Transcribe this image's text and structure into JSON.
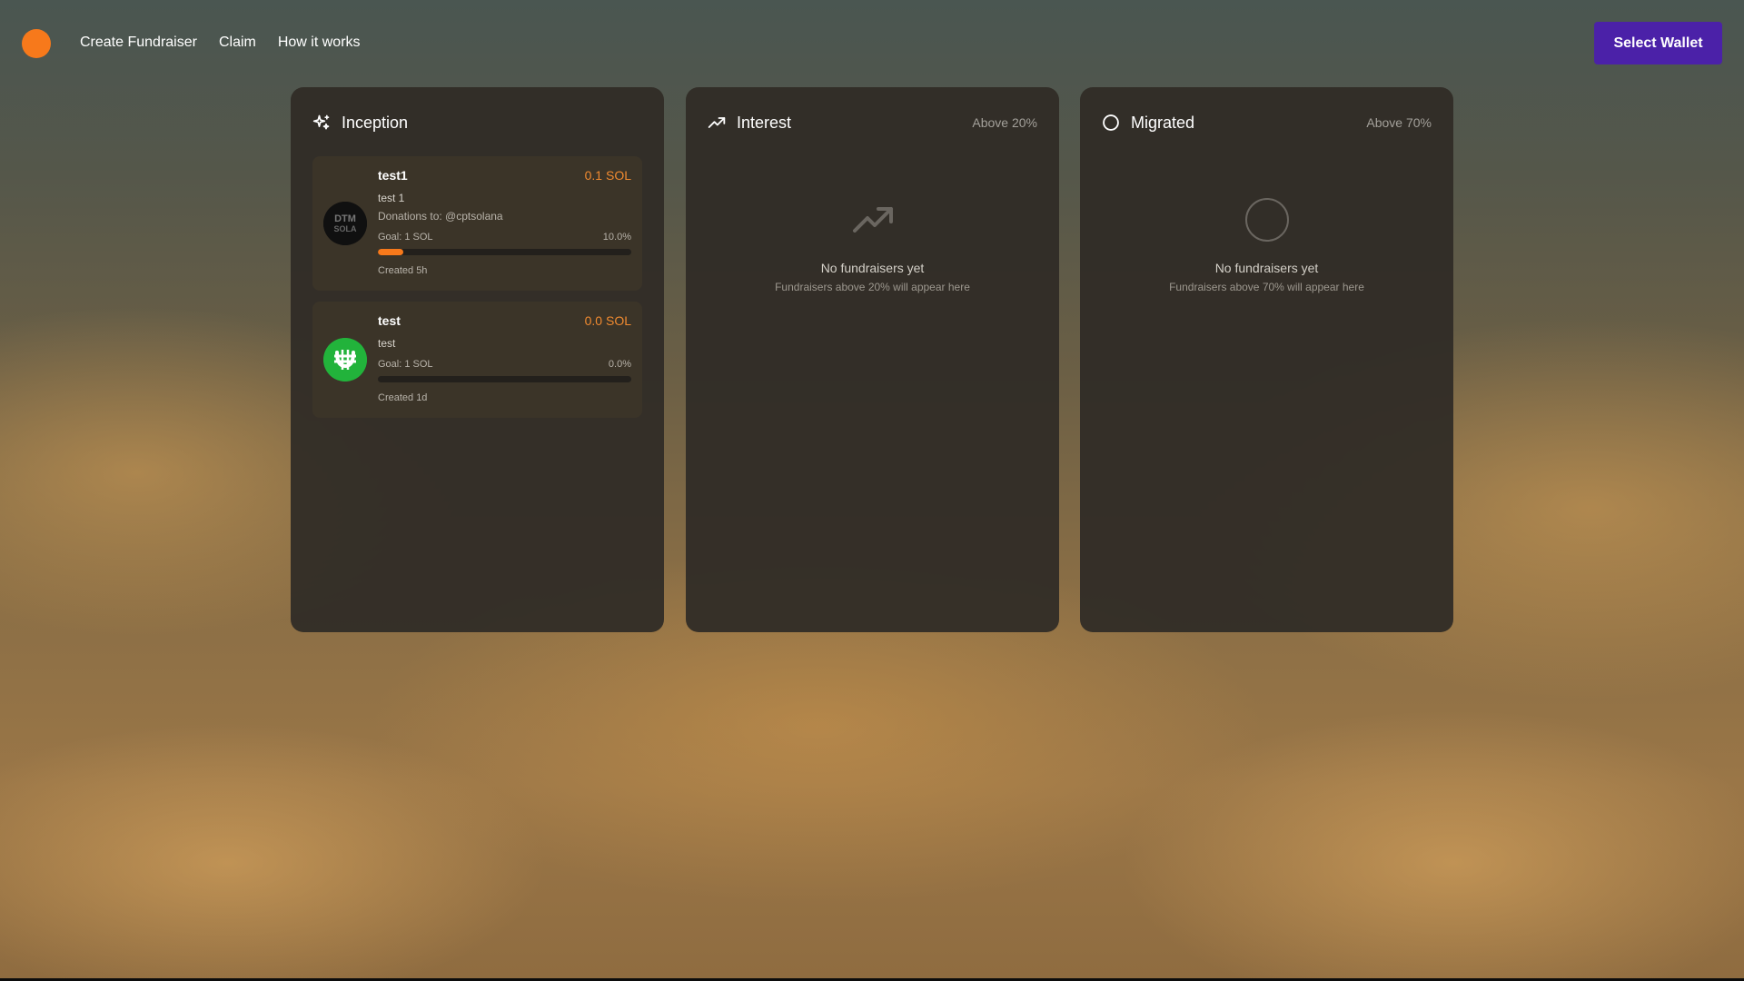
{
  "header": {
    "nav": [
      {
        "label": "Create Fundraiser"
      },
      {
        "label": "Claim"
      },
      {
        "label": "How it works"
      }
    ],
    "wallet_button": "Select Wallet",
    "logo_color": "#f7791b",
    "wallet_button_color": "#4b21a8"
  },
  "columns": {
    "inception": {
      "title": "Inception",
      "icon": "sparkles-icon",
      "cards": [
        {
          "name": "test1",
          "amount": "0.1 SOL",
          "description": "test 1",
          "recipient": "Donations to: @cptsolana",
          "goal": "Goal: 1 SOL",
          "percent_label": "10.0%",
          "progress": 0.1,
          "created": "Created 5h",
          "avatar": "dark-text-logo-avatar"
        },
        {
          "name": "test",
          "amount": "0.0 SOL",
          "description": "test",
          "goal": "Goal: 1 SOL",
          "percent_label": "0.0%",
          "progress": 0.0,
          "created": "Created 1d",
          "avatar": "green-bitcoin-avatar"
        }
      ]
    },
    "interest": {
      "title": "Interest",
      "icon": "trending-up-icon",
      "threshold": "Above 20%",
      "empty_title": "No fundraisers yet",
      "empty_sub": "Fundraisers above 20% will appear here"
    },
    "migrated": {
      "title": "Migrated",
      "icon": "circle-icon",
      "threshold": "Above 70%",
      "empty_title": "No fundraisers yet",
      "empty_sub": "Fundraisers above 70% will appear here"
    }
  },
  "accent_color": "#f08a30"
}
